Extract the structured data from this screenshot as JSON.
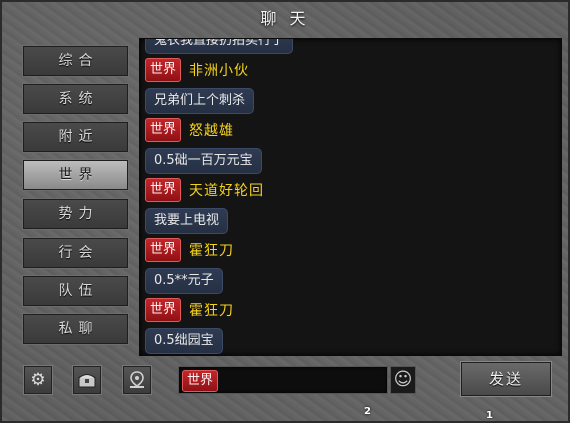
{
  "window": {
    "title": "聊 天"
  },
  "tabs": [
    {
      "label": "综合",
      "active": false
    },
    {
      "label": "系统",
      "active": false
    },
    {
      "label": "附近",
      "active": false
    },
    {
      "label": "世界",
      "active": true
    },
    {
      "label": "势力",
      "active": false
    },
    {
      "label": "行会",
      "active": false
    },
    {
      "label": "队伍",
      "active": false
    },
    {
      "label": "私聊",
      "active": false
    }
  ],
  "messages": [
    {
      "type": "text",
      "text": "鬼衣我直接扔拍卖行了"
    },
    {
      "type": "name",
      "channel": "世界",
      "name": "非洲小伙"
    },
    {
      "type": "text",
      "text": "兄弟们上个刺杀"
    },
    {
      "type": "name",
      "channel": "世界",
      "name": "怒越雄"
    },
    {
      "type": "text",
      "text": "0.5础一百万元宝"
    },
    {
      "type": "name",
      "channel": "世界",
      "name": "天道好轮回"
    },
    {
      "type": "text",
      "text": "我要上电视"
    },
    {
      "type": "name",
      "channel": "世界",
      "name": "霍狂刀"
    },
    {
      "type": "text",
      "text": "0.5**元子"
    },
    {
      "type": "name",
      "channel": "世界",
      "name": "霍狂刀"
    },
    {
      "type": "text",
      "text": "0.5绌园宝"
    }
  ],
  "bottom": {
    "settings_icon": "gear-icon",
    "gift_icon": "chest-icon",
    "location_icon": "location-pin-icon",
    "input_channel": "世界",
    "input_value": "",
    "emoji_icon": "smiley-icon",
    "send_label": "发送"
  },
  "markers": {
    "m1": "2",
    "m2": "1"
  },
  "colors": {
    "name_color": "#f6d21a",
    "badge_red": "#b01c20",
    "bubble_blue": "#2b364c"
  }
}
